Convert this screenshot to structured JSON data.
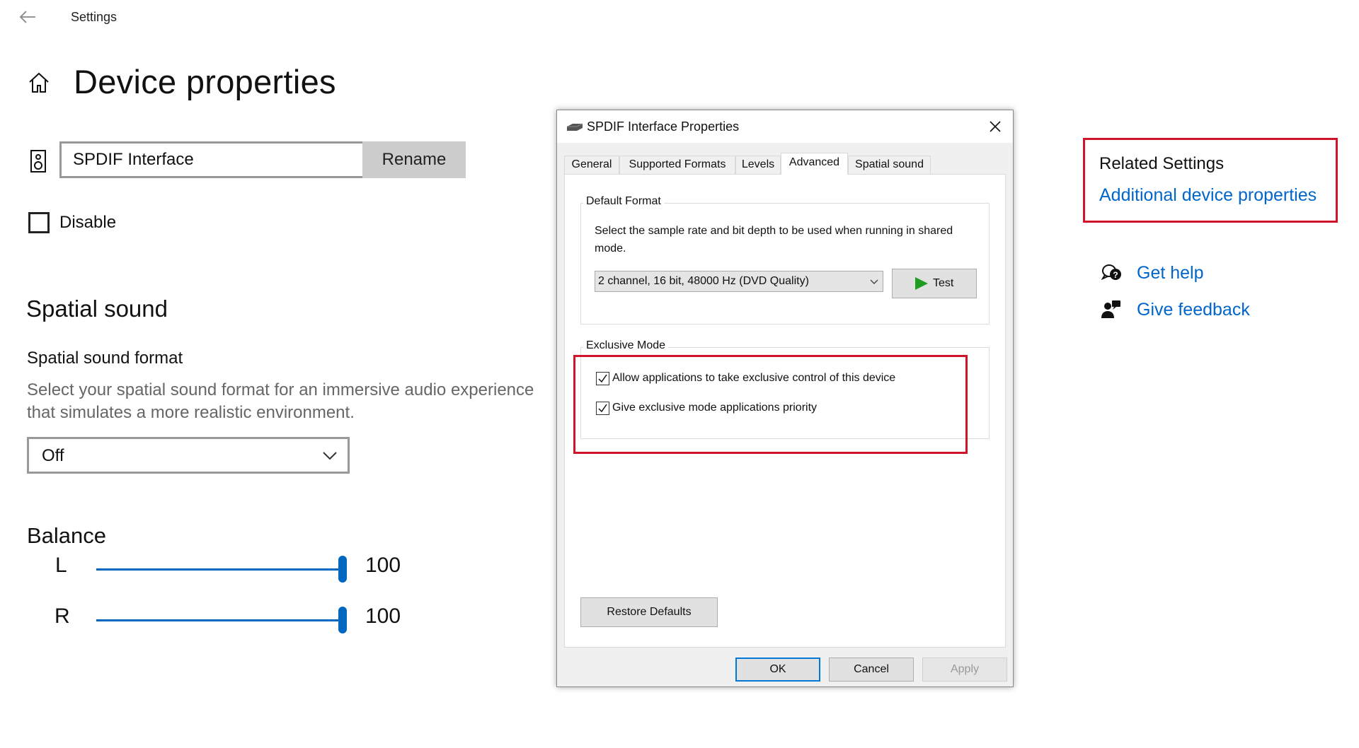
{
  "app": {
    "title": "Settings",
    "page_title": "Device properties"
  },
  "device": {
    "name_value": "SPDIF Interface",
    "rename_label": "Rename",
    "disable_label": "Disable",
    "disable_checked": false
  },
  "spatial": {
    "heading": "Spatial sound",
    "format_label": "Spatial sound format",
    "description": "Select your spatial sound format for an immersive audio experience that simulates a more realistic environment.",
    "selected": "Off"
  },
  "balance": {
    "heading": "Balance",
    "channels": [
      {
        "label": "L",
        "value": "100",
        "fraction": 1.0
      },
      {
        "label": "R",
        "value": "100",
        "fraction": 1.0
      }
    ]
  },
  "dialog": {
    "title": "SPDIF Interface Properties",
    "tabs": [
      {
        "label": "General"
      },
      {
        "label": "Supported Formats"
      },
      {
        "label": "Levels"
      },
      {
        "label": "Advanced",
        "active": true
      },
      {
        "label": "Spatial sound"
      }
    ],
    "default_format": {
      "group_label": "Default Format",
      "description": "Select the sample rate and bit depth to be used when running in shared mode.",
      "selected": "2 channel, 16 bit, 48000 Hz (DVD Quality)",
      "test_label": "Test"
    },
    "exclusive_mode": {
      "group_label": "Exclusive Mode",
      "options": [
        {
          "label": "Allow applications to take exclusive control of this device",
          "checked": true
        },
        {
          "label": "Give exclusive mode applications priority",
          "checked": true
        }
      ]
    },
    "restore_label": "Restore Defaults",
    "buttons": {
      "ok": "OK",
      "cancel": "Cancel",
      "apply": "Apply"
    }
  },
  "related": {
    "title": "Related Settings",
    "link": "Additional device properties"
  },
  "help": {
    "get_help": "Get help",
    "give_feedback": "Give feedback"
  },
  "colors": {
    "accent": "#0067c0",
    "highlight": "#d0142a",
    "link": "#0066cc",
    "play_green": "#1f9d1f"
  }
}
